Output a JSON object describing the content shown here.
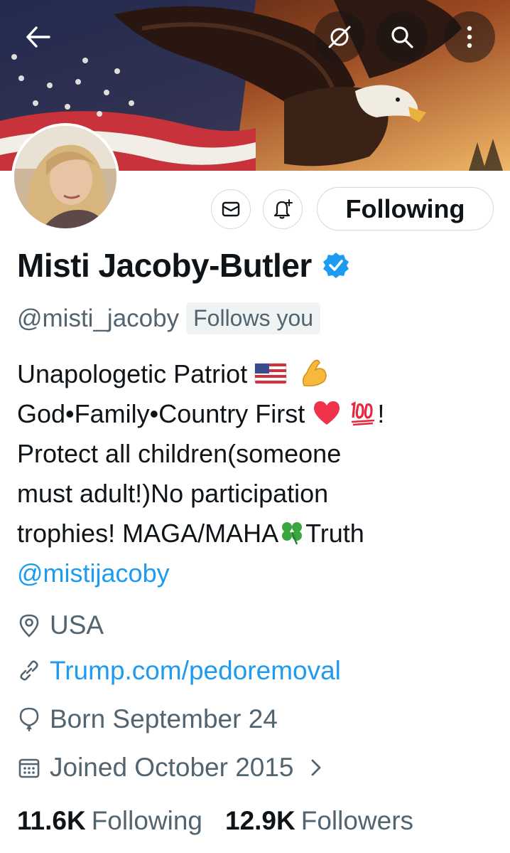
{
  "profile": {
    "display_name": "Misti Jacoby-Butler",
    "handle": "@misti_jacoby",
    "follows_you_badge": "Follows you",
    "follow_state_label": "Following",
    "bio": {
      "line1_text": "Unapologetic Patriot",
      "line2_text": "God•Family•Country First",
      "line2_suffix": "!",
      "line3": "Protect all children(someone",
      "line4": "must adult!)No participation",
      "line5_text": "trophies! MAGA/MAHA",
      "line5_suffix": "Truth",
      "mention": "@mistijacoby"
    },
    "location": "USA",
    "website": "Trump.com/pedoremoval",
    "birthday": "Born September 24",
    "joined": "Joined October 2015",
    "following_count": "11.6K",
    "following_label": "Following",
    "followers_count": "12.9K",
    "followers_label": "Followers"
  },
  "icons": {
    "top_bar": [
      "back-arrow-icon",
      "grok-icon",
      "search-icon",
      "more-vertical-icon"
    ],
    "actions": [
      "message-icon",
      "notification-bell-icon"
    ],
    "meta": [
      "location-pin-icon",
      "link-icon",
      "balloon-icon",
      "calendar-icon",
      "chevron-right-icon"
    ]
  },
  "colors": {
    "accent_link": "#1d9bf0",
    "secondary_text": "#536471",
    "primary_text": "#0f1419",
    "border": "#cfd9de"
  }
}
